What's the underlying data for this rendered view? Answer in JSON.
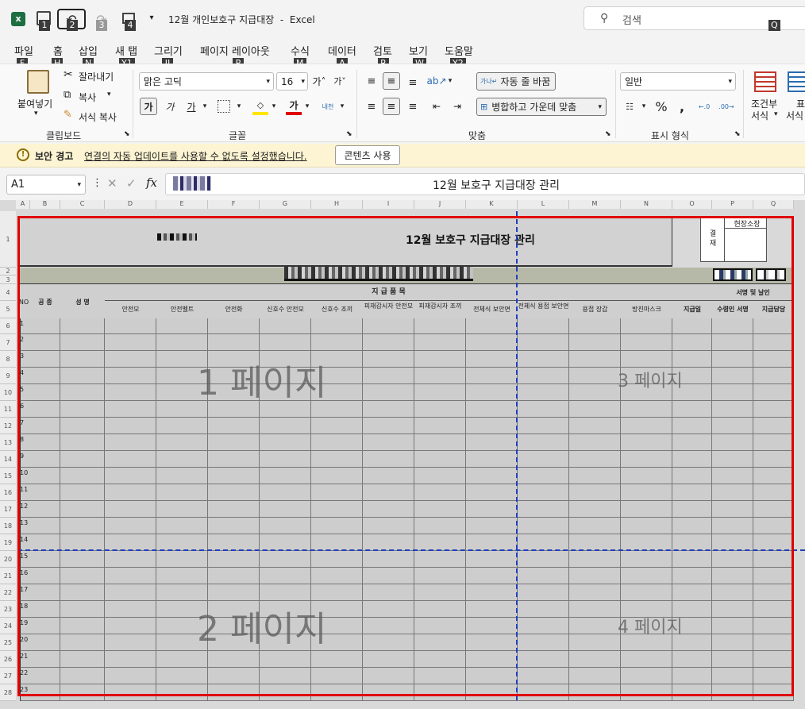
{
  "titlebar": {
    "title": "12월 개인보호구 지급대장  -  Excel",
    "search_placeholder": "검색",
    "keytips": [
      "1",
      "2",
      "3",
      "4"
    ],
    "search_keytip": "Q"
  },
  "menu": [
    {
      "label": "파일",
      "key": "F"
    },
    {
      "label": "홈",
      "key": "H"
    },
    {
      "label": "삽입",
      "key": "N"
    },
    {
      "label": "새 탭",
      "key": "Y1"
    },
    {
      "label": "그리기",
      "key": "JI"
    },
    {
      "label": "페이지 레이아웃",
      "key": "P"
    },
    {
      "label": "수식",
      "key": "M"
    },
    {
      "label": "데이터",
      "key": "A"
    },
    {
      "label": "검토",
      "key": "R"
    },
    {
      "label": "보기",
      "key": "W"
    },
    {
      "label": "도움말",
      "key": "Y2"
    }
  ],
  "ribbon": {
    "clipboard": {
      "paste": "붙여넣기",
      "cut": "잘라내기",
      "copy": "복사",
      "format_painter": "서식 복사",
      "group": "클립보드"
    },
    "font": {
      "name": "맑은 고딕",
      "size": "16",
      "bold": "가",
      "italic": "가",
      "underline": "가",
      "group": "글꼴"
    },
    "align": {
      "wrap": "자동 줄 바꿈",
      "merge": "병합하고 가운데 맞춤",
      "group": "맞춤"
    },
    "number": {
      "format": "일반",
      "group": "표시 형식"
    },
    "styles": {
      "cond_line1": "조건부",
      "cond_line2": "서식",
      "table_line1": "표",
      "table_line2": "서식"
    }
  },
  "security": {
    "title": "보안 경고",
    "message": "연결의 자동 업데이트를 사용할 수 없도록 설정했습니다.",
    "button": "콘텐츠 사용"
  },
  "formula": {
    "namebox": "A1",
    "content": "12월 보호구 지급대장 관리"
  },
  "columns": [
    "A",
    "B",
    "C",
    "D",
    "E",
    "F",
    "G",
    "H",
    "I",
    "J",
    "K",
    "L",
    "M",
    "N",
    "O",
    "P",
    "Q"
  ],
  "rows": [
    "1",
    "2",
    "3",
    "4",
    "5",
    "6",
    "7",
    "8",
    "9",
    "10",
    "11",
    "12",
    "13",
    "14",
    "15",
    "16",
    "17",
    "18",
    "19",
    "20",
    "21",
    "22",
    "23",
    "24",
    "25",
    "26",
    "27",
    "28"
  ],
  "sheet": {
    "title": "12월 보호구 지급대장 관리",
    "approval": {
      "side": "결재",
      "box": "현장소장"
    },
    "h_no": "NO",
    "h_trade": "공 종",
    "h_name": "성 명",
    "h_items": "지 급 품 목",
    "h_sign": "서명 및 날인",
    "items": [
      "안전모",
      "안전벨트",
      "안전화",
      "신호수 안전모",
      "신호수 조끼",
      "피재감시자 안전모",
      "피재감시자 조끼",
      "전체식 보안면",
      "전체식 용접 보안면",
      "용접 장갑",
      "방진마스크",
      "지급일",
      "수령인 서명",
      "지급담당"
    ],
    "row_nums": [
      "1",
      "2",
      "3",
      "4",
      "5",
      "6",
      "7",
      "8",
      "9",
      "10",
      "11",
      "12",
      "13",
      "14",
      "15",
      "16",
      "17",
      "18",
      "19",
      "20",
      "21",
      "22",
      "23"
    ],
    "pages": [
      "1 페이지",
      "2 페이지",
      "3 페이지",
      "4 페이지"
    ]
  }
}
